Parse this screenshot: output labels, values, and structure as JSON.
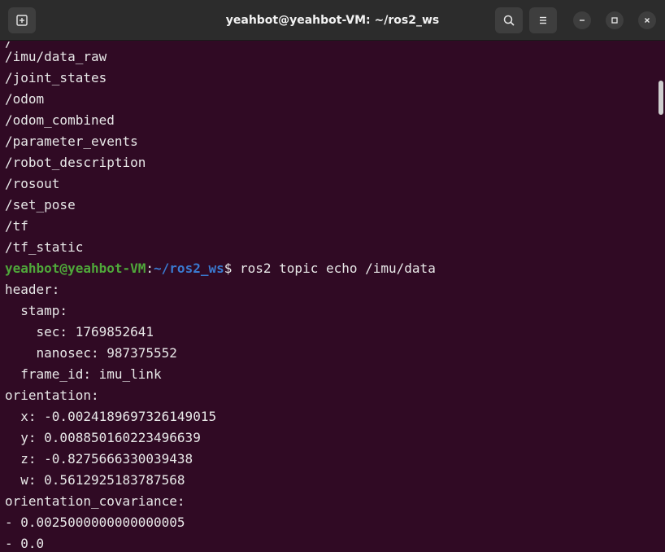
{
  "window": {
    "title": "yeahbot@yeahbot-VM: ~/ros2_ws"
  },
  "titlebar": {
    "icons": {
      "new_tab": "new-tab-icon",
      "search": "search-icon",
      "menu": "hamburger-menu-icon",
      "minimize": "minimize-icon",
      "maximize": "maximize-icon",
      "close": "close-icon"
    }
  },
  "colors": {
    "background": "#300a24",
    "titlebar": "#2c2c2c",
    "prompt_user": "#4fa83a",
    "prompt_path": "#3a7ad0",
    "text": "#e8e8e8"
  },
  "terminal": {
    "topic_list": [
      "/imu/data_raw",
      "/joint_states",
      "/odom",
      "/odom_combined",
      "/parameter_events",
      "/robot_description",
      "/rosout",
      "/set_pose",
      "/tf",
      "/tf_static"
    ],
    "prompt": {
      "user_host": "yeahbot@yeahbot-VM",
      "colon": ":",
      "path": "~/ros2_ws",
      "symbol": "$ ",
      "command": "ros2 topic echo /imu/data"
    },
    "output": [
      "header:",
      "  stamp:",
      "    sec: 1769852641",
      "    nanosec: 987375552",
      "  frame_id: imu_link",
      "orientation:",
      "  x: -0.0024189697326149015",
      "  y: 0.008850160223496639",
      "  z: -0.8275666330039438",
      "  w: 0.5612925183787568",
      "orientation_covariance:",
      "- 0.0025000000000000005",
      "- 0.0"
    ]
  }
}
